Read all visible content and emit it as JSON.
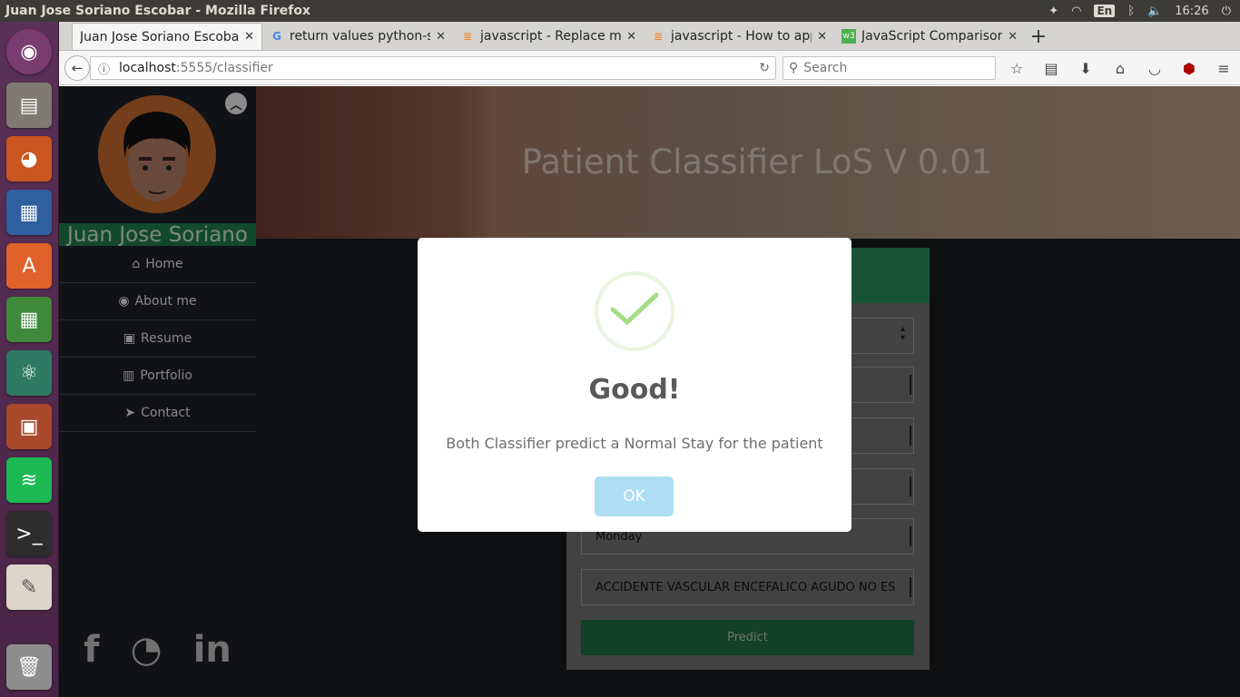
{
  "system": {
    "window_title": "Juan Jose Soriano Escobar - Mozilla Firefox",
    "keyboard_layout": "En",
    "clock": "16:26"
  },
  "browser": {
    "tabs": [
      {
        "title": "Juan Jose Soriano Escobar",
        "icon": "page-icon",
        "active": true
      },
      {
        "title": "return values python-s",
        "icon": "google-icon",
        "active": false
      },
      {
        "title": "javascript - Replace mu",
        "icon": "stackoverflow-icon",
        "active": false
      },
      {
        "title": "javascript - How to app",
        "icon": "stackoverflow-icon",
        "active": false
      },
      {
        "title": "JavaScript Comparison",
        "icon": "w3-icon",
        "active": false
      }
    ],
    "url_host": "localhost",
    "url_rest": ":5555/classifier",
    "search_placeholder": "Search"
  },
  "sidebar": {
    "name": "Juan Jose Soriano",
    "menu": [
      {
        "label": "Home",
        "icon": "home-icon"
      },
      {
        "label": "About me",
        "icon": "user-circle-icon"
      },
      {
        "label": "Resume",
        "icon": "id-badge-icon"
      },
      {
        "label": "Portfolio",
        "icon": "briefcase-icon"
      },
      {
        "label": "Contact",
        "icon": "paper-plane-icon"
      }
    ],
    "social": [
      "facebook-icon",
      "github-icon",
      "linkedin-icon"
    ]
  },
  "hero": {
    "title": "Patient Classifier LoS V 0.01"
  },
  "form": {
    "day_value": "Monday",
    "diagnosis_value": "ACCIDENTE VASCULAR ENCEFALICO AGUDO NO ES",
    "predict_label": "Predict"
  },
  "modal": {
    "title": "Good!",
    "message": "Both Classifier predict a Normal Stay for the patient",
    "ok_label": "OK"
  },
  "colors": {
    "accent_green": "#1f7a4c",
    "ok_button": "#aedef4",
    "check_green": "#a5dc86"
  }
}
